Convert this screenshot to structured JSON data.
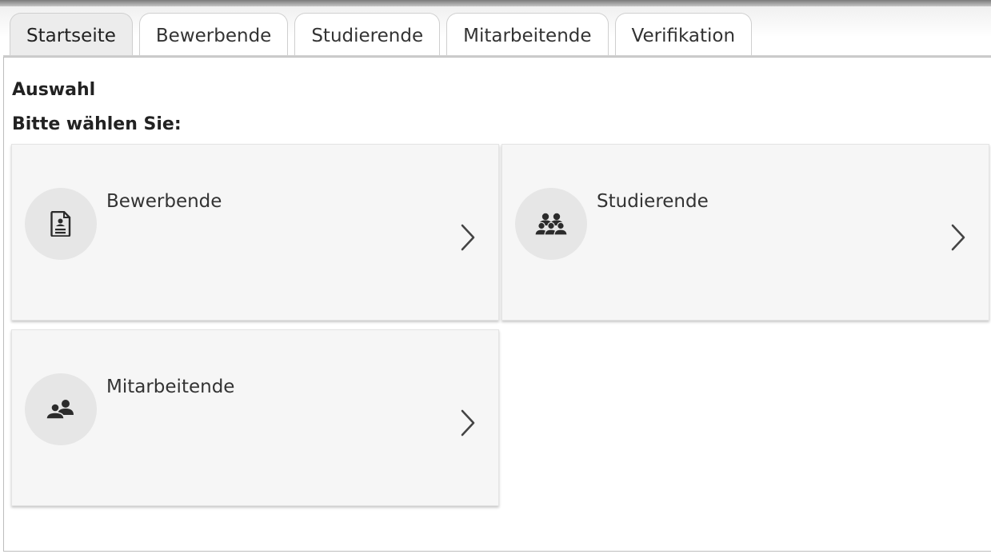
{
  "tabs": [
    {
      "label": "Startseite",
      "active": true
    },
    {
      "label": "Bewerbende",
      "active": false
    },
    {
      "label": "Studierende",
      "active": false
    },
    {
      "label": "Mitarbeitende",
      "active": false
    },
    {
      "label": "Verifikation",
      "active": false
    }
  ],
  "content": {
    "section_title": "Auswahl",
    "prompt": "Bitte wählen Sie:"
  },
  "cards": [
    {
      "label": "Bewerbende",
      "icon": "applicant-document-icon"
    },
    {
      "label": "Studierende",
      "icon": "students-group-icon"
    },
    {
      "label": "Mitarbeitende",
      "icon": "employees-icon"
    }
  ],
  "colors": {
    "card_background": "#f6f6f6",
    "icon_circle": "#e6e6e6",
    "icon_glyph": "#2b2b2b",
    "active_tab": "#ececec"
  }
}
